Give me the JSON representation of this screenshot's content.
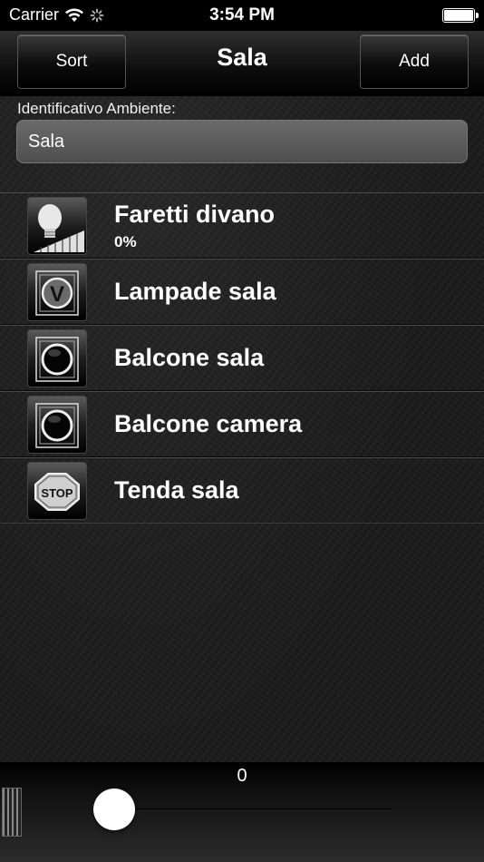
{
  "status_bar": {
    "carrier": "Carrier",
    "time": "3:54 PM"
  },
  "nav": {
    "left_button": "Sort",
    "title": "Sala",
    "right_button": "Add"
  },
  "room_field": {
    "label": "Identificativo Ambiente:",
    "value": "Sala"
  },
  "devices": [
    {
      "name": "Faretti divano",
      "subtitle": "0%",
      "icon": "dimmer-bulb-icon"
    },
    {
      "name": "Lampade sala",
      "icon": "v-switch-icon"
    },
    {
      "name": "Balcone sala",
      "icon": "round-button-icon"
    },
    {
      "name": "Balcone camera",
      "icon": "round-button-icon"
    },
    {
      "name": "Tenda sala",
      "icon": "stop-sign-icon"
    }
  ],
  "toolbar": {
    "slider_value_label": "0",
    "slider_value": 0
  }
}
